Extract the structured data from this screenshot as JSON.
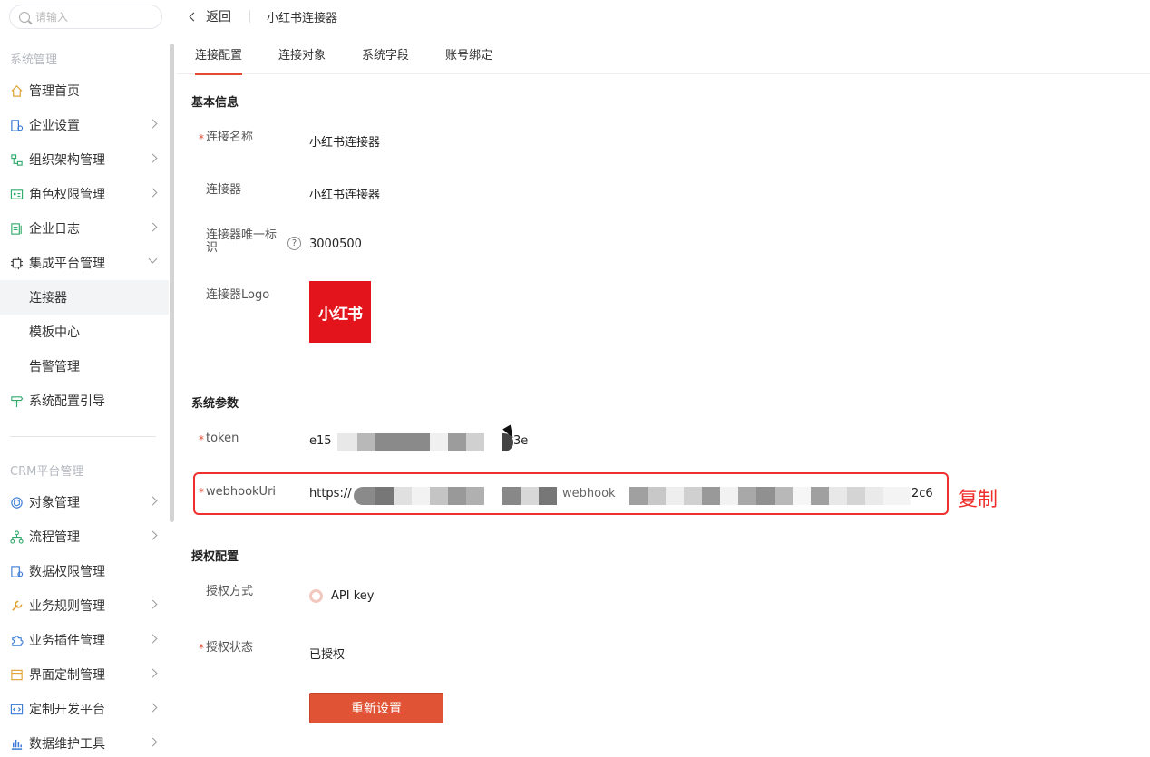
{
  "search": {
    "placeholder": "请输入"
  },
  "sidebar": {
    "section_system": "系统管理",
    "section_crm": "CRM平台管理",
    "items": [
      {
        "label": "管理首页",
        "icon": "home-icon"
      },
      {
        "label": "企业设置",
        "icon": "building-icon"
      },
      {
        "label": "组织架构管理",
        "icon": "org-chart-icon"
      },
      {
        "label": "角色权限管理",
        "icon": "id-card-icon"
      },
      {
        "label": "企业日志",
        "icon": "log-icon"
      },
      {
        "label": "集成平台管理",
        "icon": "chip-icon"
      },
      {
        "label": "连接器",
        "icon": ""
      },
      {
        "label": "模板中心",
        "icon": ""
      },
      {
        "label": "告警管理",
        "icon": ""
      },
      {
        "label": "系统配置引导",
        "icon": "signpost-icon"
      }
    ],
    "crm_items": [
      {
        "label": "对象管理",
        "icon": "cube-icon"
      },
      {
        "label": "流程管理",
        "icon": "flow-icon"
      },
      {
        "label": "数据权限管理",
        "icon": "data-permission-icon"
      },
      {
        "label": "业务规则管理",
        "icon": "wrench-icon"
      },
      {
        "label": "业务插件管理",
        "icon": "puzzle-icon"
      },
      {
        "label": "界面定制管理",
        "icon": "layout-icon"
      },
      {
        "label": "定制开发平台",
        "icon": "code-icon"
      },
      {
        "label": "数据维护工具",
        "icon": "bar-chart-icon"
      }
    ]
  },
  "header": {
    "back": "返回",
    "breadcrumb": "小红书连接器"
  },
  "tabs": [
    "连接配置",
    "连接对象",
    "系统字段",
    "账号绑定"
  ],
  "basic": {
    "title": "基本信息",
    "name_label": "连接名称",
    "name_value": "小红书连接器",
    "connector_label": "连接器",
    "connector_value": "小红书连接器",
    "uid_label_1": "连接器唯一标",
    "uid_label_2": "识",
    "uid_value": "3000500",
    "help": "?",
    "logo_label": "连接器Logo",
    "logo_text": "小红书"
  },
  "params": {
    "title": "系统参数",
    "token_label": "token",
    "token_prefix": "e15",
    "token_suffix": "3e",
    "webhook_label": "webhookUri",
    "webhook_prefix": "https://",
    "webhook_mid": "webhook",
    "webhook_suffix": "2c6",
    "annotation": "复制"
  },
  "auth": {
    "title": "授权配置",
    "method_label": "授权方式",
    "method_value": "API key",
    "status_label": "授权状态",
    "status_value": "已授权",
    "reset_button": "重新设置"
  },
  "required_mark": "*",
  "colors": {
    "accent": "#e15335",
    "annotation": "#f0302e",
    "logo_bg": "#e3141c"
  }
}
